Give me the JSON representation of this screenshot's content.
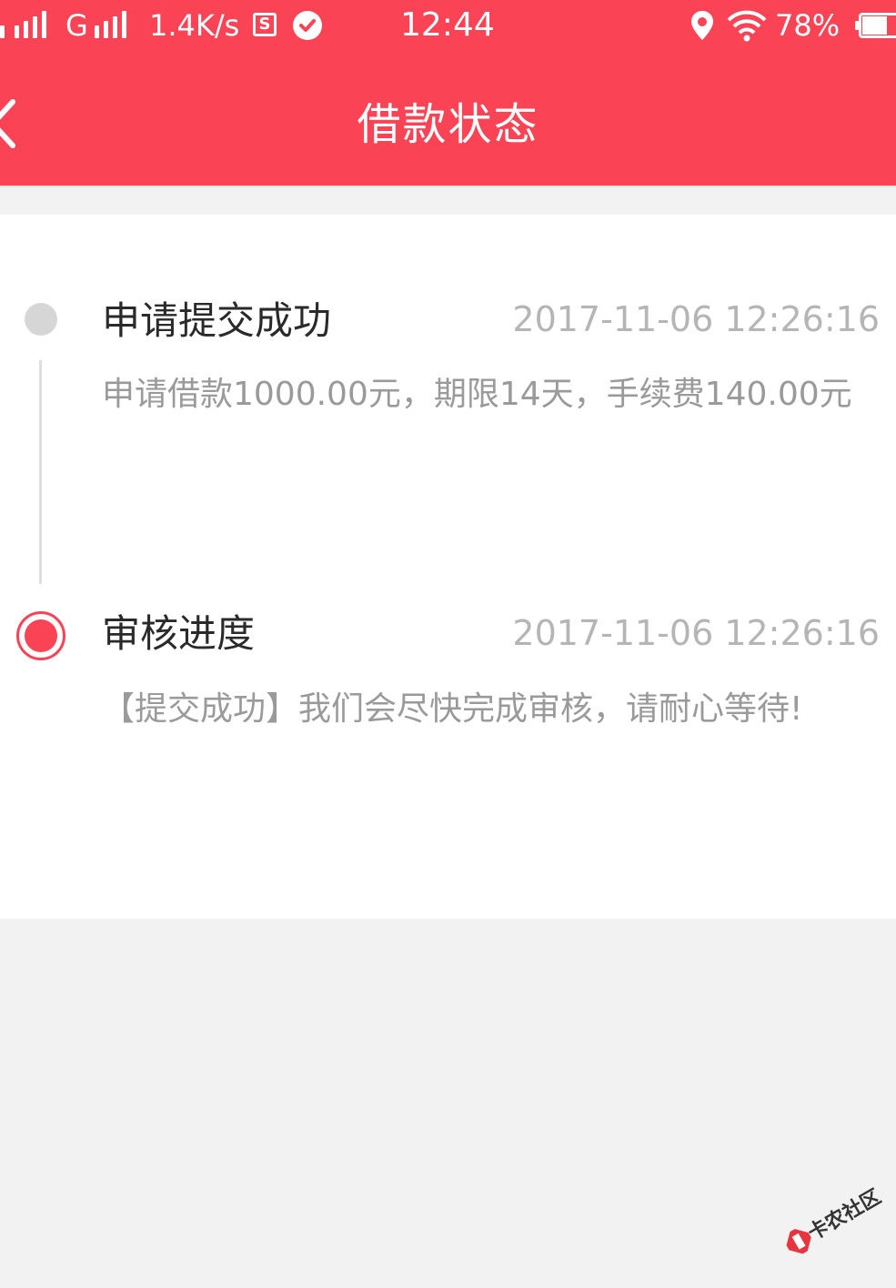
{
  "status_bar": {
    "network_1": "",
    "network_2": "G",
    "speed": "1.4K/s",
    "sim_icon": "S",
    "time": "12:44",
    "battery": "78%",
    "battery_level": 0.78,
    "icons": [
      "signal-icon",
      "signal-icon",
      "sim-icon",
      "check-circle-icon",
      "location-icon",
      "wifi-icon",
      "battery-icon"
    ]
  },
  "nav": {
    "title": "借款状态",
    "back_icon": "chevron-left-icon"
  },
  "colors": {
    "brand": "#fb4356",
    "inactive_dot": "#d6d6d6",
    "line": "#dedede",
    "text_primary": "#2a2a2a",
    "text_secondary": "#9a9a9a",
    "text_time": "#b5b5b5",
    "background": "#f2f2f2"
  },
  "timeline": [
    {
      "title": "申请提交成功",
      "time": "2017-11-06 12:26:16",
      "description": "申请借款1000.00元，期限14天，手续费140.00元",
      "active": false
    },
    {
      "title": "审核进度",
      "time": "2017-11-06 12:26:16",
      "description": "【提交成功】我们会尽快完成审核，请耐心等待!",
      "active": true
    }
  ],
  "watermark": {
    "text": "卡农社区"
  }
}
